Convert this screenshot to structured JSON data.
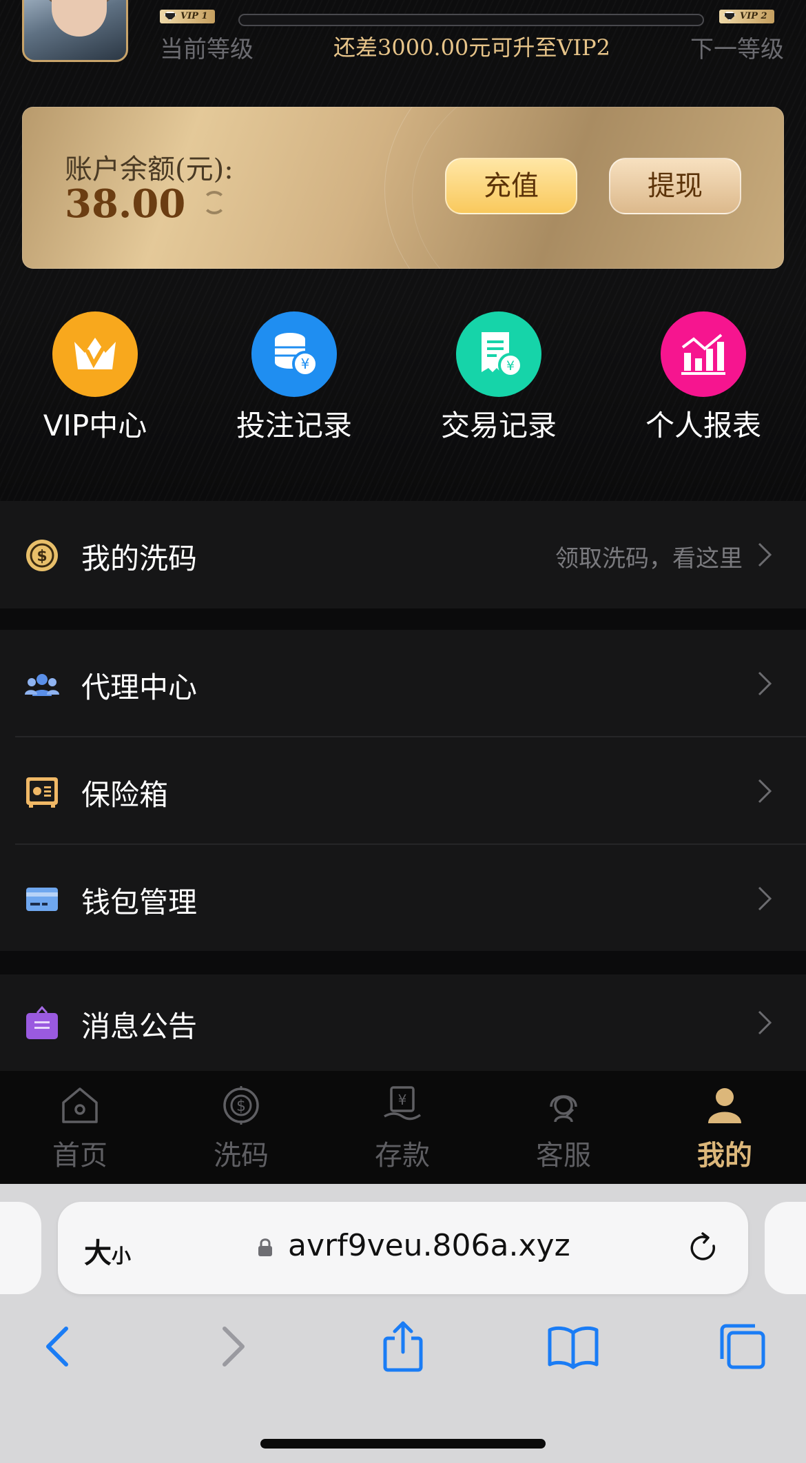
{
  "vip": {
    "current_badge": "VIP 1",
    "next_badge": "VIP 2",
    "current_label": "当前等级",
    "next_label": "下一等级",
    "upgrade_text": "还差3000.00元可升至VIP2",
    "progress": 0.0
  },
  "balance": {
    "label": "账户余额(元):",
    "value": "38.00",
    "charge_label": "充值",
    "withdraw_label": "提现"
  },
  "quick_actions": [
    {
      "label": "VIP中心",
      "icon": "crown-icon",
      "color": "#f8a81d"
    },
    {
      "label": "投注记录",
      "icon": "coins-icon",
      "color": "#1f8ef1"
    },
    {
      "label": "交易记录",
      "icon": "receipt-icon",
      "color": "#16d4a9"
    },
    {
      "label": "个人报表",
      "icon": "chart-icon",
      "color": "#f6158f"
    }
  ],
  "menu": {
    "rebate": {
      "title": "我的洗码",
      "hint": "领取洗码，看这里"
    },
    "agent": {
      "title": "代理中心"
    },
    "safe": {
      "title": "保险箱"
    },
    "wallet": {
      "title": "钱包管理"
    },
    "notice": {
      "title": "消息公告"
    }
  },
  "tabs": [
    {
      "label": "首页",
      "icon": "home-icon"
    },
    {
      "label": "洗码",
      "icon": "rebate-icon"
    },
    {
      "label": "存款",
      "icon": "deposit-icon"
    },
    {
      "label": "客服",
      "icon": "support-icon"
    },
    {
      "label": "我的",
      "icon": "profile-icon",
      "active": true
    }
  ],
  "browser": {
    "text_size_label": "大",
    "text_size_small": "小",
    "url": "avrf9veu.806a.xyz"
  },
  "colors": {
    "accent_gold": "#dcb77a",
    "background": "#0b0b0c",
    "ios_blue": "#1a7cf5"
  }
}
